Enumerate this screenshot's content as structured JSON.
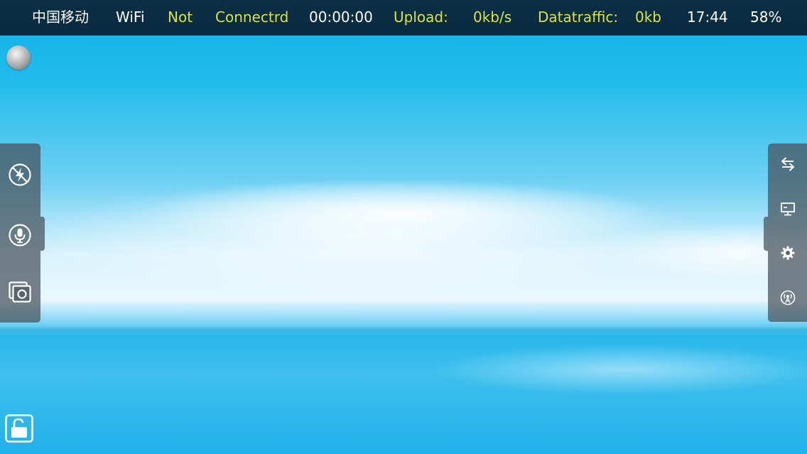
{
  "status_bar": {
    "carrier": "中国移动",
    "network": "WiFi",
    "connection_word1": "Not",
    "connection_word2": "Connectrd",
    "timer": "00:00:00",
    "upload_label": "Upload:",
    "upload_value": "0kb/s",
    "traffic_label": "Datatraffic:",
    "traffic_value": "0kb",
    "clock": "17:44",
    "battery": "58%"
  },
  "colors": {
    "status_bar_bg": "#0b2d43",
    "status_text": "#ffffff",
    "status_highlight": "#d8e343",
    "panel_bg": "#46505a"
  },
  "left_toolbar": [
    {
      "icon": "flash-off-icon"
    },
    {
      "icon": "microphone-icon"
    },
    {
      "icon": "photo-capture-icon"
    }
  ],
  "right_toolbar": [
    {
      "icon": "swap-arrows-icon"
    },
    {
      "icon": "monitor-icon"
    },
    {
      "icon": "gear-icon"
    },
    {
      "icon": "broadcast-icon"
    }
  ],
  "overlay": {
    "record_indicator": "record-ball-icon",
    "lock": "unlock-icon"
  }
}
